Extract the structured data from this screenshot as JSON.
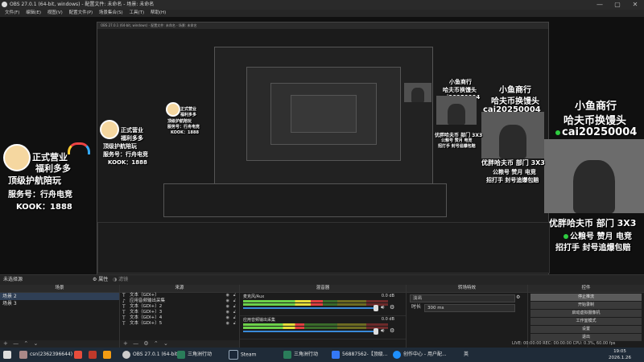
{
  "window": {
    "title": "OBS 27.0.1 (64-bit, windows) - 配置文件: 未命名 - 场景: 未命名",
    "controls": [
      "—",
      "▢",
      "✕"
    ]
  },
  "menu": [
    "文件(F)",
    "编辑(E)",
    "视图(V)",
    "配置文件(P)",
    "场景集合(S)",
    "工具(T)",
    "帮助(H)"
  ],
  "overlay": {
    "promo_lines": [
      "正式营业",
      "福利多多",
      "顶级护航陪玩",
      "服务号：行舟电竞",
      "KOOK：1888"
    ],
    "ad_title": "小鱼商行",
    "ad_subtitle": "哈夫币换馒头",
    "ad_wechat": "cai20250004",
    "stream_tag": "优胖哈夫币 部门 3X3",
    "stream_sub": "公粮号 赞月 电竞",
    "stream_sub2": "招打手 封号追爆包赔"
  },
  "nested": {
    "bar_text": "OBS 27.0.1 (64-bit, windows) - 配置文件: 未命名 - 场景: 未命名",
    "taskbar": [
      "csn(2362396644)",
      "OBS 27.0.1 (64-bit...",
      "三角洲行动",
      "Steam",
      "三角洲行动",
      "56887562-...",
      "创作中心 - 用户配..."
    ]
  },
  "scene_bar": {
    "label": "未选择源",
    "properties": "属性",
    "filters": "滤镜"
  },
  "scenes": {
    "header": "场景",
    "items": [
      "场景 2",
      "场景 3"
    ],
    "footer": [
      "+",
      "—",
      "⌃",
      "⌄"
    ]
  },
  "sources": {
    "header": "来源",
    "items": [
      "文本（GDI+）",
      "应用音频输出采集",
      "文本（GDI+）2",
      "文本（GDI+）3",
      "文本（GDI+）4",
      "文本（GDI+）5"
    ],
    "footer": [
      "+",
      "—",
      "⚙",
      "⌃",
      "⌄"
    ]
  },
  "mixer": {
    "header": "混音器",
    "channels": [
      {
        "name": "麦克风/Aux",
        "db": "0.0 dB",
        "level": 0.55
      },
      {
        "name": "应用音频输出采集",
        "db": "0.0 dB",
        "level": 0.42
      }
    ]
  },
  "transitions": {
    "header": "转场特效",
    "type": "淡出",
    "duration_label": "时长",
    "duration": "300 ms"
  },
  "controls": {
    "header": "控件",
    "buttons": [
      "停止推流",
      "开始录制",
      "启动虚拟摄像机",
      "工作室模式",
      "设置",
      "退出"
    ]
  },
  "status": {
    "line": "LIVE: 00:00:00   REC: 00:00:00   CPU: 0.3%, 60.00 fps"
  },
  "taskbar": {
    "items": [
      "csn(2362396644)",
      "OBS 27.0.1 (64-bit...",
      "三角洲行动",
      "Steam",
      "三角洲行动",
      "56887562-【顶级...",
      "创作中心 - 用户配..."
    ],
    "tray_lang": "英",
    "time": "19:05",
    "date": "2026.1.26"
  },
  "colors": {
    "bg": "#1e1e1e",
    "meter_green": "#6cd14a",
    "meter_yellow": "#e6de3a",
    "meter_red": "#e04040",
    "accent": "#3a8ad8"
  }
}
